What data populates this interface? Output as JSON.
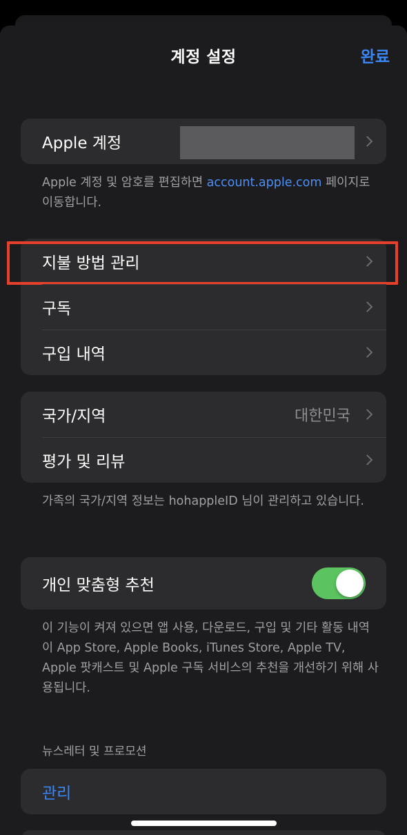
{
  "nav": {
    "title": "계정 설정",
    "done_label": "완료"
  },
  "apple_account": {
    "label": "Apple 계정",
    "footnote_prefix": "Apple 계정 및 암호를 편집하면 ",
    "footnote_link": "account.apple.com",
    "footnote_suffix": " 페이지로 이동합니다."
  },
  "payments_group": {
    "items": [
      {
        "label": "지불 방법 관리"
      },
      {
        "label": "구독"
      },
      {
        "label": "구입 내역"
      }
    ]
  },
  "region_group": {
    "country_label": "국가/지역",
    "country_value": "대한민국",
    "ratings_label": "평가 및 리뷰",
    "footnote": "가족의 국가/지역 정보는 hohappleID 님이 관리하고 있습니다."
  },
  "personalized": {
    "label": "개인 맞춤형 추천",
    "toggle_on": true,
    "footnote": "이 기능이 켜져 있으면 앱 사용, 다운로드, 구입 및 기타 활동 내역이 App Store, Apple Books, iTunes Store, Apple TV, Apple 팟캐스트 및 Apple 구독 서비스의 추천을 개선하기 위해 사용됩니다."
  },
  "newsletter": {
    "header": "뉴스레터 및 프로모션",
    "manage_label": "관리"
  },
  "colors": {
    "accent": "#3a86f5",
    "toggle_on": "#5bc35f",
    "highlight": "#e8412b"
  }
}
